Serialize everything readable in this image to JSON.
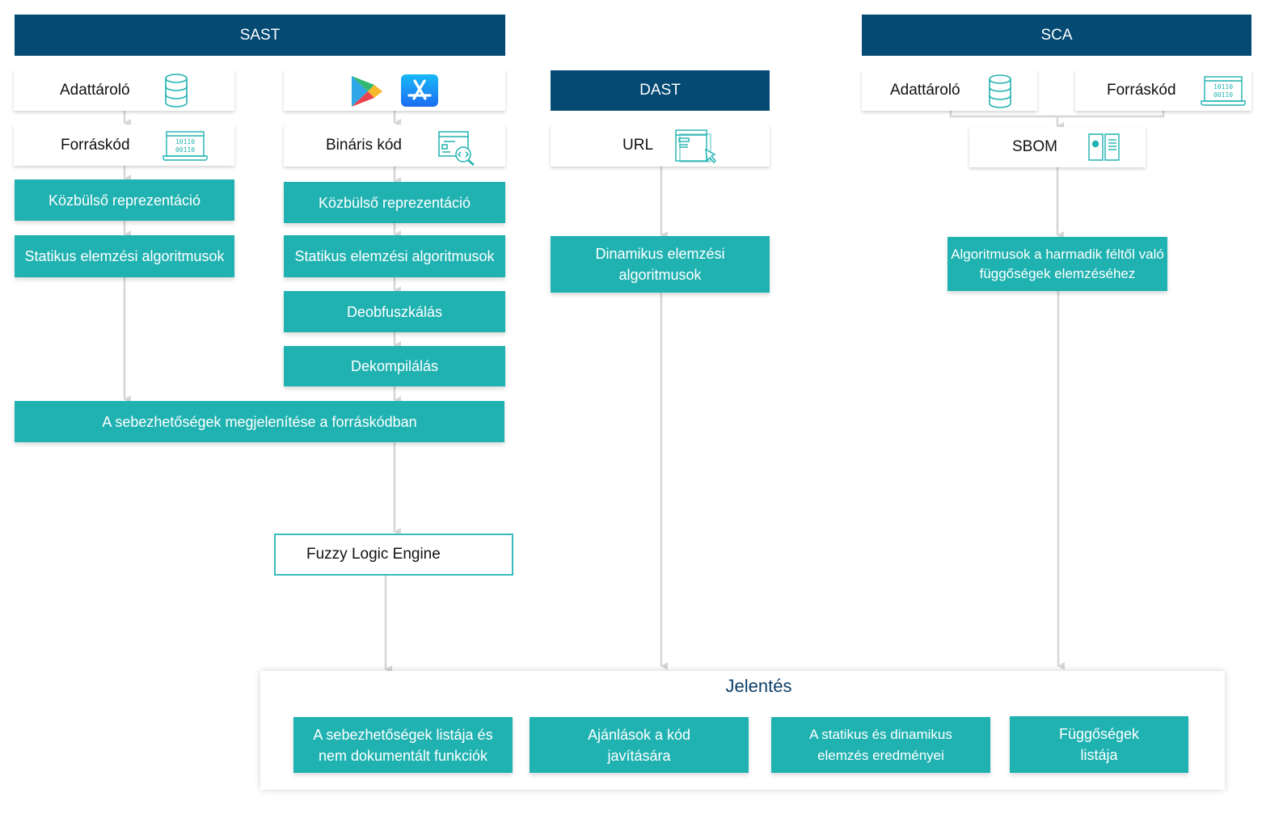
{
  "colors": {
    "header": "#044a73",
    "teal": "#20b2b1",
    "connector": "#d6d6d6",
    "report_title": "#0b3f6b"
  },
  "sast": {
    "title": "SAST",
    "source_column": {
      "repository": {
        "label": "Adattároló",
        "icon": "database-icon"
      },
      "source_code": {
        "label": "Forráskód",
        "icon": "laptop-binary-icon",
        "icon_text": [
          "10110",
          "00110"
        ]
      },
      "steps": [
        "Közbülső reprezentáció",
        "Statikus elemzési algoritmusok"
      ]
    },
    "binary_column": {
      "stores": [
        "google-play-icon",
        "app-store-icon"
      ],
      "binary_code": {
        "label": "Bináris kód",
        "icon": "code-inspect-icon"
      },
      "steps": [
        "Közbülső reprezentáció",
        "Statikus elemzési algoritmusok",
        "Deobfuszkálás",
        "Dekompilálás"
      ]
    },
    "merge": "A sebezhetőségek megjelenítése a forráskódban"
  },
  "dast": {
    "title": "DAST",
    "url": {
      "label": "URL",
      "icon": "browser-cursor-icon"
    },
    "step": "Dinamikus elemzési algoritmusok"
  },
  "sca": {
    "title": "SCA",
    "repository": {
      "label": "Adattároló",
      "icon": "database-icon"
    },
    "source_code": {
      "label": "Forráskód",
      "icon": "laptop-binary-icon",
      "icon_text": [
        "10110",
        "00110"
      ]
    },
    "sbom": {
      "label": "SBOM",
      "icon": "sbom-book-icon"
    },
    "step": "Algoritmusok a harmadik féltől való függőségek elemzéséhez"
  },
  "fuzzy": "Fuzzy Logic Engine",
  "report": {
    "title": "Jelentés",
    "items": [
      "A sebezhetőségek listája és nem dokumentált funkciók",
      "Ajánlások a kód javítására",
      "A statikus és dinamikus elemzés eredményei",
      "Függőségek listája"
    ]
  }
}
